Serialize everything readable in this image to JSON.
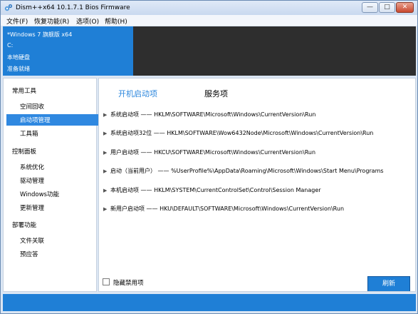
{
  "window": {
    "title": "Dism++x64 10.1.7.1 Bios Firmware",
    "controls": {
      "minimize": "—",
      "maximize": "□",
      "close": "✕"
    }
  },
  "menu": {
    "items": [
      "文件(F)",
      "恢复功能(R)",
      "选项(O)",
      "帮助(H)"
    ]
  },
  "status": {
    "lines": [
      "*Windows 7 旗舰版 x64",
      "C:",
      "本地硬盘",
      "准备就绪"
    ]
  },
  "sidebar": {
    "group1": "常用工具",
    "group1_items": [
      "空间回收",
      "启动项管理",
      "工具箱"
    ],
    "group2": "控制面板",
    "group2_items": [
      "系统优化",
      "驱动管理",
      "Windows功能",
      "更新管理"
    ],
    "group3": "部署功能",
    "group3_items": [
      "文件关联",
      "预应答"
    ]
  },
  "main": {
    "tabs": [
      "开机启动项",
      "服务项"
    ],
    "entries": [
      "系统启动项 —— HKLM\\SOFTWARE\\Microsoft\\Windows\\CurrentVersion\\Run",
      "系统启动项32位 —— HKLM\\SOFTWARE\\Wow6432Node\\Microsoft\\Windows\\CurrentVersion\\Run",
      "用户启动项 —— HKCU\\SOFTWARE\\Microsoft\\Windows\\CurrentVersion\\Run",
      "启动（当前用户） —— %UserProfile%\\AppData\\Roaming\\Microsoft\\Windows\\Start Menu\\Programs",
      "本机启动项 —— HKLM\\SYSTEM\\CurrentControlSet\\Control\\Session Manager",
      "新用户启动项 —— HKU\\DEFAULT\\SOFTWARE\\Microsoft\\Windows\\CurrentVersion\\Run"
    ],
    "hide_disabled_label": "隐藏禁用项",
    "refresh_label": "刷新"
  },
  "colors": {
    "accent": "#1f7fd6",
    "tab_active": "#2b86dd",
    "dark_panel": "#2e2e2e"
  }
}
